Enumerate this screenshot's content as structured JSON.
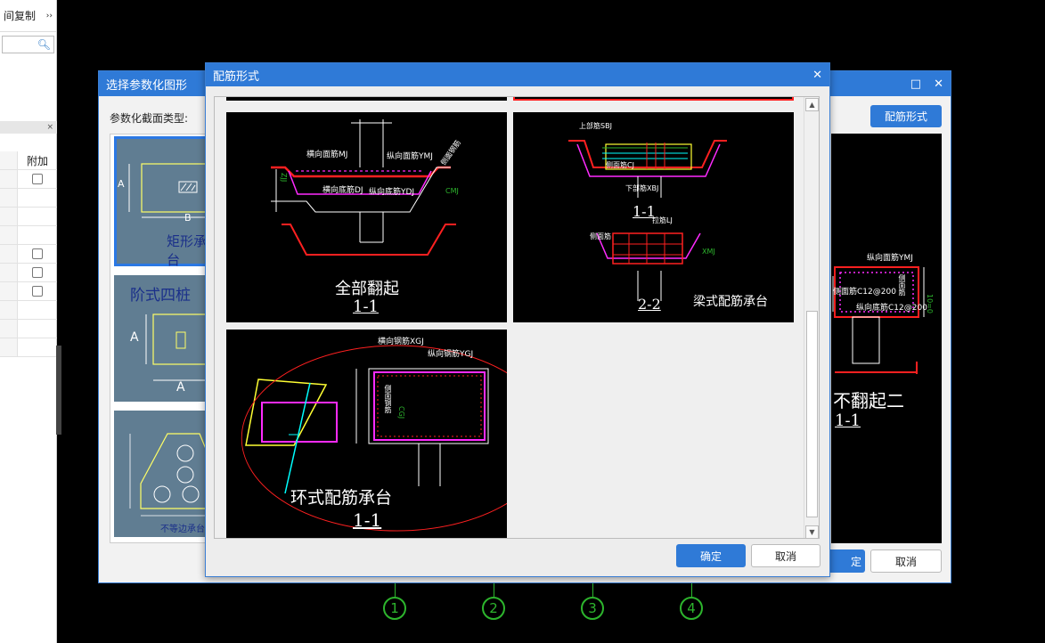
{
  "left_panel": {
    "header_label": "间复制",
    "expand_icon": "double-chevron-right-icon",
    "search_icon": "search-icon",
    "close_mark": "×",
    "column_header": "附加"
  },
  "outer_dialog": {
    "title": "选择参数化图形",
    "section_label": "参数化截面类型:",
    "rebar_button": "配筋形式",
    "ok_label": "定",
    "cancel_label": "取消",
    "thumbnails": [
      {
        "label": "矩形承台",
        "dim_a": "A",
        "dim_b": "B"
      },
      {
        "label": "阶式四桩",
        "dim_a": "A",
        "dim_b": "A"
      },
      {
        "label": "不等边承台"
      }
    ],
    "preview": {
      "title": "不翻起二",
      "section": "1-1",
      "top_label": "纵向面筋YMJ",
      "bottom_label": "纵向底筋C12@200",
      "side_label": "侧面筋C12@200",
      "side_text": "侧面筋",
      "dim_label": "10=0"
    }
  },
  "inner_dialog": {
    "title": "配筋形式",
    "ok_label": "确定",
    "cancel_label": "取消",
    "options": [
      {
        "title": "全部翻起",
        "section": "1-1",
        "labels": {
          "h_top": "横向面筋MJ",
          "v_top": "纵向面筋YMJ",
          "h_bot": "横向底筋DJ",
          "v_bot": "纵向底筋YDJ",
          "side1": "侧面钢筋",
          "cmj": "CMJ",
          "zjj": "ZJJ"
        }
      },
      {
        "title": "梁式配筋承台",
        "section_a": "1-1",
        "section_b": "2-2",
        "labels": {
          "top": "上部筋SBJ",
          "bot": "下部筋XBJ",
          "face": "侧面筋CJ",
          "rc": "拉筋LJ",
          "mid": "侧面筋",
          "xmj": "XMJ"
        }
      },
      {
        "title": "环式配筋承台",
        "section": "1-1",
        "labels": {
          "h": "横向钢筋XGJ",
          "v": "纵向钢筋YGJ",
          "side": "侧面钢筋",
          "cgj": "CGJ"
        }
      }
    ]
  },
  "axis_markers": [
    "1",
    "2",
    "3",
    "4"
  ],
  "colors": {
    "accent": "#2f7ad7",
    "rebar_red": "#ff2020",
    "rebar_magenta": "#ff2bff",
    "axis_green": "#2db52d"
  }
}
